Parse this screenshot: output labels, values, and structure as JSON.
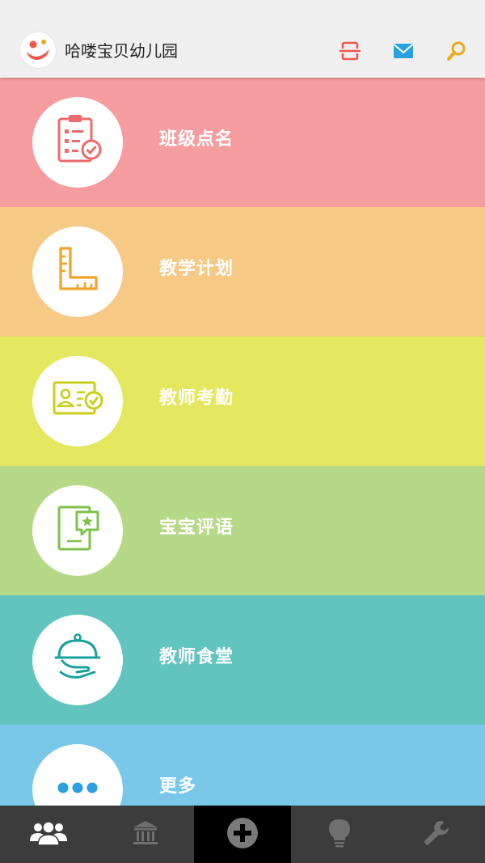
{
  "header": {
    "app_title": "哈喽宝贝幼儿园",
    "logo_icon": "smiley-logo-icon",
    "actions": [
      {
        "name": "scan-icon",
        "color": "#f0584e"
      },
      {
        "name": "mail-icon",
        "color": "#2aa0e0"
      },
      {
        "name": "search-icon",
        "color": "#f0a818"
      }
    ]
  },
  "menu": {
    "items": [
      {
        "label": "班级点名",
        "icon": "clipboard-check-icon",
        "bg": "#f59d9f",
        "icon_color": "#ef6a6a"
      },
      {
        "label": "教学计划",
        "icon": "ruler-icon",
        "bg": "#f6c984",
        "icon_color": "#f0a52a"
      },
      {
        "label": "教师考勤",
        "icon": "id-card-check-icon",
        "bg": "#e3e85f",
        "icon_color": "#c9cf1c"
      },
      {
        "label": "宝宝评语",
        "icon": "comment-star-icon",
        "bg": "#b6d987",
        "icon_color": "#7fc24b"
      },
      {
        "label": "教师食堂",
        "icon": "food-cloche-icon",
        "bg": "#62c4bf",
        "icon_color": "#17a39b"
      },
      {
        "label": "更多",
        "icon": "more-dots-icon",
        "bg": "#79c8e9",
        "icon_color": "#2aa0e0"
      }
    ]
  },
  "tabbar": {
    "tabs": [
      {
        "name": "people-icon",
        "active": true
      },
      {
        "name": "institution-icon",
        "active": false
      },
      {
        "name": "add-circle-icon",
        "active": false
      },
      {
        "name": "lightbulb-icon",
        "active": false
      },
      {
        "name": "wrench-icon",
        "active": false
      }
    ]
  }
}
